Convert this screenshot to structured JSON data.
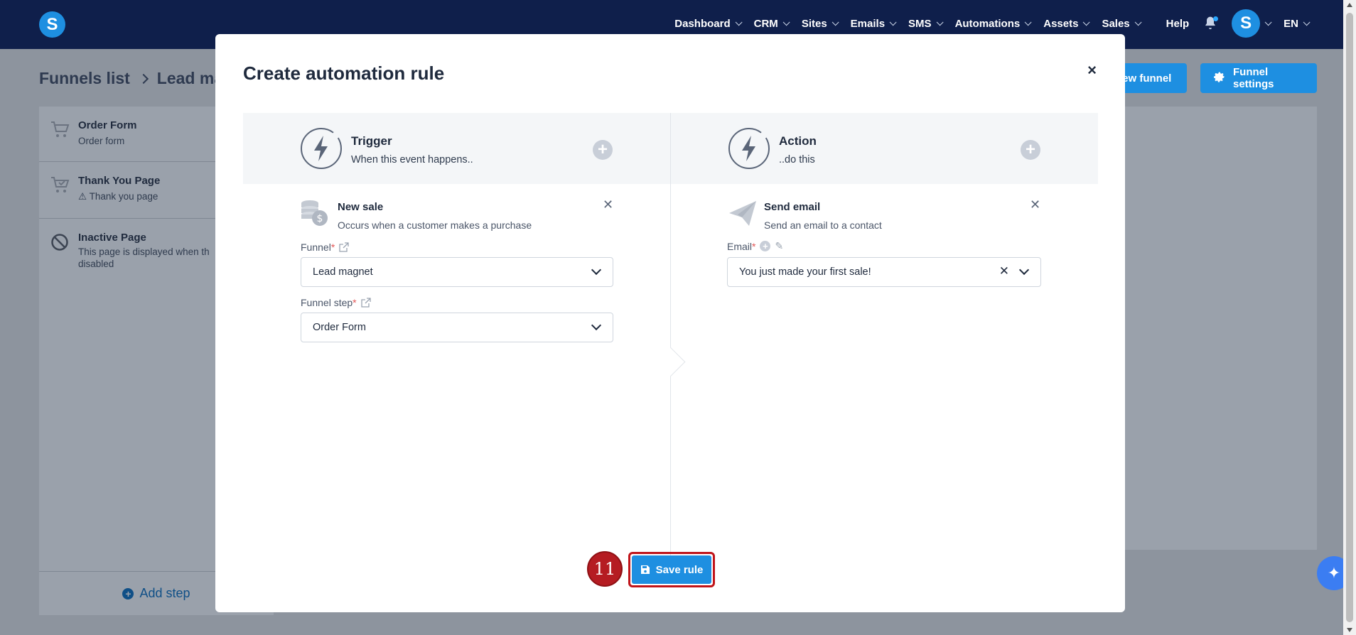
{
  "app": {
    "logo_letter": "S",
    "brand_color": "#1e8fe1",
    "nav_background": "#0f1f4b"
  },
  "nav": {
    "items": [
      "Dashboard",
      "CRM",
      "Sites",
      "Emails",
      "SMS",
      "Automations",
      "Assets",
      "Sales"
    ],
    "help": "Help",
    "avatar_letter": "S",
    "language": "EN"
  },
  "page": {
    "breadcrumb_root": "Funnels list",
    "breadcrumb_current": "Lead mag",
    "view_funnel_button": "iew funnel",
    "funnel_settings_button": "Funnel settings"
  },
  "sidebar": {
    "steps": [
      {
        "title": "Order Form",
        "subtitle": "Order form",
        "icon": "cart-icon"
      },
      {
        "title": "Thank You Page",
        "subtitle": "Thank you page",
        "icon": "cart-check-icon"
      },
      {
        "title": "Inactive Page",
        "subtitle": "This page is displayed when th",
        "subtitle2": "disabled",
        "icon": "ban-icon"
      }
    ],
    "add_step": "Add step"
  },
  "modal": {
    "title": "Create automation rule",
    "close_symbol": "×",
    "trigger": {
      "title": "Trigger",
      "subtitle": "When this event happens.."
    },
    "action": {
      "title": "Action",
      "subtitle": "..do this"
    },
    "trigger_block": {
      "title": "New sale",
      "subtitle": "Occurs when a customer makes a purchase",
      "funnel_label": "Funnel",
      "funnel_value": "Lead magnet",
      "funnel_step_label": "Funnel step",
      "funnel_step_value": "Order Form"
    },
    "action_block": {
      "title": "Send email",
      "subtitle": "Send an email to a contact",
      "email_label": "Email",
      "email_value": "You just made your first sale!"
    },
    "save_button": "Save rule",
    "step_badge": "11"
  }
}
